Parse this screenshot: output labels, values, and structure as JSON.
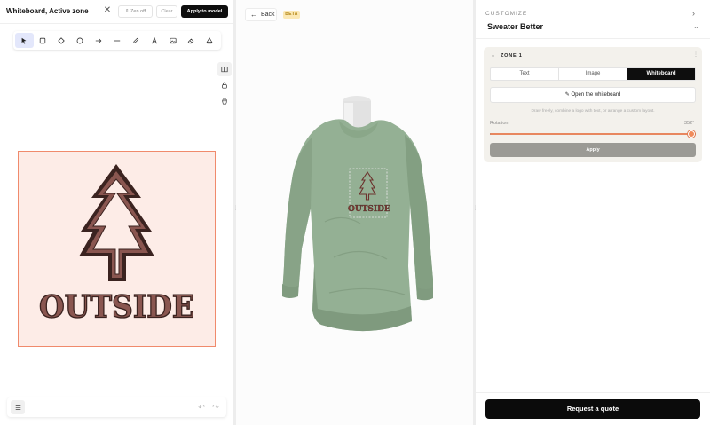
{
  "left_panel": {
    "title": "Whiteboard, Active zone",
    "close_icon": "close-icon",
    "zen_off_label": "Zen off",
    "clear_label": "Clear",
    "apply_label": "Apply to model",
    "tools": [
      {
        "name": "select-tool",
        "icon": "pointer-icon",
        "active": true
      },
      {
        "name": "rectangle-tool",
        "icon": "square-icon"
      },
      {
        "name": "diamond-tool",
        "icon": "diamond-icon"
      },
      {
        "name": "ellipse-tool",
        "icon": "circle-icon"
      },
      {
        "name": "arrow-tool",
        "icon": "arrow-icon"
      },
      {
        "name": "line-tool",
        "icon": "line-icon"
      },
      {
        "name": "pencil-tool",
        "icon": "pencil-icon"
      },
      {
        "name": "text-tool",
        "icon": "text-icon"
      },
      {
        "name": "image-tool",
        "icon": "image-icon"
      },
      {
        "name": "eraser-tool",
        "icon": "eraser-icon"
      },
      {
        "name": "shapes-tool",
        "icon": "shapes-icon"
      }
    ],
    "side_icons": [
      "book-icon",
      "lock-icon",
      "hand-icon"
    ],
    "canvas": {
      "design_text": "OUTSIDE",
      "frame_color": "#f08a6c",
      "background_color": "#fdece7"
    },
    "bottom": {
      "menu_icon": "menu-icon",
      "undo_icon": "undo-icon",
      "redo_icon": "redo-icon"
    }
  },
  "center_panel": {
    "back_label": "Back",
    "beta_label": "BETA",
    "model_design_text": "OUTSIDE",
    "sweater_color": "#94b094"
  },
  "right_panel": {
    "section_label": "CUSTOMIZE",
    "product_name": "Sweater Better",
    "zone": {
      "label": "ZONE 1",
      "tabs": [
        "Text",
        "Image",
        "Whiteboard"
      ],
      "active_tab": "Whiteboard",
      "open_whiteboard_label": "Open the whiteboard",
      "hint": "Draw freely, combine a logo with text, or arrange a custom layout.",
      "rotation_label": "Rotation",
      "rotation_value": "352°",
      "rotation_fraction": 0.978,
      "apply_label": "Apply"
    },
    "request_quote_label": "Request a quote"
  }
}
